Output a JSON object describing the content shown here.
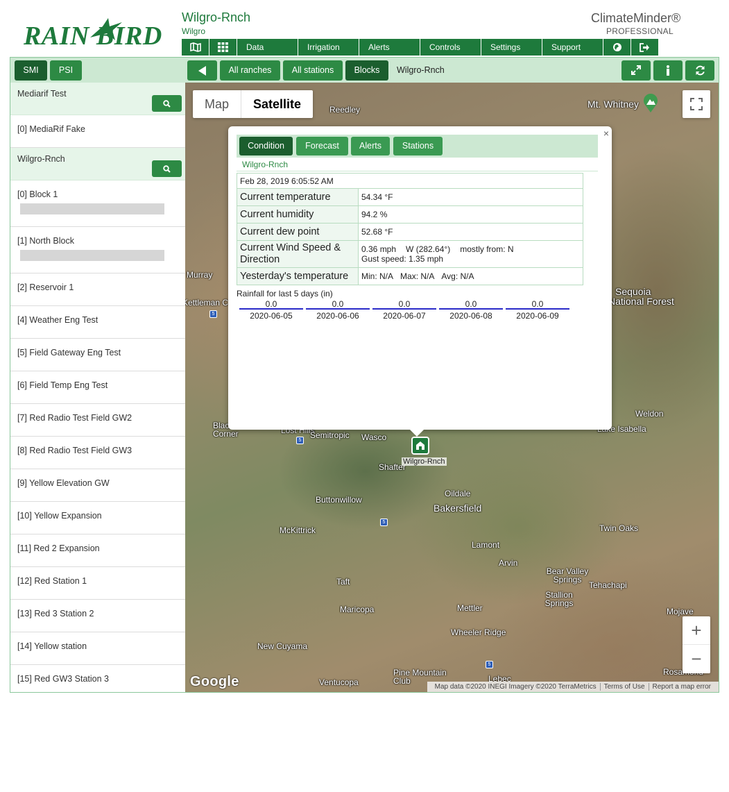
{
  "brand": {
    "logo_text": "RAIN BIRD",
    "color": "#1e7a3c"
  },
  "header": {
    "ranch_title": "Wilgro-Rnch",
    "ranch_subtitle": "Wilgro",
    "product_title": "ClimateMinder®",
    "product_subtitle": "PROFESSIONAL"
  },
  "nav": {
    "icons": [
      "map-icon",
      "grid-icon"
    ],
    "items": [
      "Data",
      "Irrigation",
      "Alerts",
      "Controls",
      "Settings",
      "Support"
    ],
    "right_icons": [
      "globe-icon",
      "sign-out-icon"
    ]
  },
  "toolbar": {
    "smi": "SMI",
    "psi": "PSI",
    "all_ranches": "All ranches",
    "all_stations": "All stations",
    "blocks": "Blocks",
    "current": "Wilgro-Rnch"
  },
  "sidebar": {
    "groups": [
      {
        "name": "Mediarif Test",
        "items": [
          {
            "label": "[0] MediaRif Fake",
            "bar": false
          }
        ]
      },
      {
        "name": "Wilgro-Rnch",
        "items": [
          {
            "label": "[0] Block 1",
            "bar": true
          },
          {
            "label": "[1] North Block",
            "bar": true
          },
          {
            "label": "[2] Reservoir 1",
            "bar": false
          },
          {
            "label": "[4] Weather Eng Test",
            "bar": false
          },
          {
            "label": "[5] Field Gateway Eng Test",
            "bar": false
          },
          {
            "label": "[6] Field Temp Eng Test",
            "bar": false
          },
          {
            "label": "[7] Red Radio Test Field GW2",
            "bar": false
          },
          {
            "label": "[8] Red Radio Test Field GW3",
            "bar": false
          },
          {
            "label": "[9] Yellow Elevation GW",
            "bar": false
          },
          {
            "label": "[10] Yellow Expansion",
            "bar": false
          },
          {
            "label": "[11] Red 2 Expansion",
            "bar": false
          },
          {
            "label": "[12] Red Station 1",
            "bar": false
          },
          {
            "label": "[13] Red 3 Station 2",
            "bar": false
          },
          {
            "label": "[14] Yellow station",
            "bar": false
          },
          {
            "label": "[15] Red GW3 Station 3",
            "bar": false
          }
        ]
      }
    ]
  },
  "map": {
    "type_map": "Map",
    "type_satellite": "Satellite",
    "selected_type": "Satellite",
    "places": [
      "Reedley",
      "Mt. Whitney",
      "Murray",
      "Kettleman C",
      "Sequoia",
      "National Forest",
      "Lost Hills",
      "Semitropic",
      "Wasco",
      "Shafter",
      "Buttonwillow",
      "Oildale",
      "Bakersfield",
      "McKittrick",
      "Lamont",
      "Arvin",
      "Taft",
      "Bear Valley Springs",
      "Tehachapi",
      "Stallion Springs",
      "Maricopa",
      "Mettler",
      "Wheeler Ridge",
      "New Cuyama",
      "Pine Mountain Club",
      "Lebec",
      "Ventucopa",
      "Twin Oaks",
      "Weldon",
      "Lake Isabella",
      "Mojave",
      "Rosamond",
      "Black Corner"
    ],
    "marker_label": "Wilgro-Rnch",
    "zoom_in": "+",
    "zoom_out": "−",
    "google": "Google",
    "attribution": "Map data ©2020 INEGI Imagery ©2020 TerraMetrics",
    "terms": "Terms of Use",
    "report": "Report a map error"
  },
  "popup": {
    "close": "×",
    "tabs": [
      "Condition",
      "Forecast",
      "Alerts",
      "Stations"
    ],
    "active_tab": "Condition",
    "ranch": "Wilgro-Rnch",
    "date": "Feb 28, 2019 6:05:52 AM",
    "rows": {
      "temp_label": "Current temperature",
      "temp_value": "54.34 °F",
      "humidity_label": "Current humidity",
      "humidity_value": "94.2 %",
      "dew_label": "Current dew point",
      "dew_value": "52.68 °F",
      "wind_label": "Current Wind Speed & Direction",
      "wind_speed": "0.36 mph",
      "wind_dir": "W (282.64°)",
      "wind_from": "mostly from: N",
      "gust": "Gust speed: 1.35 mph",
      "yest_label": "Yesterday's temperature",
      "yest_min": "Min: N/A",
      "yest_max": "Max: N/A",
      "yest_avg": "Avg: N/A"
    },
    "rain_title": "Rainfall for last 5 days (in)",
    "rain": [
      {
        "value": "0.0",
        "date": "2020-06-05"
      },
      {
        "value": "0.0",
        "date": "2020-06-06"
      },
      {
        "value": "0.0",
        "date": "2020-06-07"
      },
      {
        "value": "0.0",
        "date": "2020-06-08"
      },
      {
        "value": "0.0",
        "date": "2020-06-09"
      }
    ]
  }
}
